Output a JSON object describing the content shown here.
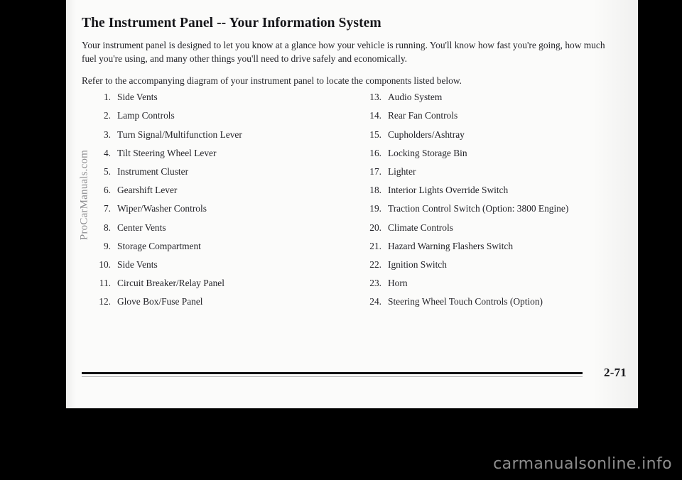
{
  "page": {
    "title": "The Instrument Panel -- Your Information System",
    "paragraphs": [
      "Your instrument panel is designed to let you know at a glance how your vehicle is running. You'll know how fast you're going, how much fuel you're using, and many other things you'll need to drive safely and economically.",
      "Refer to the accompanying diagram of your instrument panel to locate the components listed below."
    ],
    "folio": "2-71"
  },
  "components": {
    "left": [
      {
        "num": "1.",
        "label": "Side Vents"
      },
      {
        "num": "2.",
        "label": "Lamp Controls"
      },
      {
        "num": "3.",
        "label": "Turn Signal/Multifunction Lever"
      },
      {
        "num": "4.",
        "label": "Tilt Steering Wheel Lever"
      },
      {
        "num": "5.",
        "label": "Instrument Cluster"
      },
      {
        "num": "6.",
        "label": "Gearshift Lever"
      },
      {
        "num": "7.",
        "label": "Wiper/Washer Controls"
      },
      {
        "num": "8.",
        "label": "Center Vents"
      },
      {
        "num": "9.",
        "label": "Storage Compartment"
      },
      {
        "num": "10.",
        "label": "Side Vents"
      },
      {
        "num": "11.",
        "label": "Circuit Breaker/Relay Panel"
      },
      {
        "num": "12.",
        "label": "Glove Box/Fuse Panel"
      }
    ],
    "right": [
      {
        "num": "13.",
        "label": "Audio System"
      },
      {
        "num": "14.",
        "label": "Rear Fan Controls"
      },
      {
        "num": "15.",
        "label": "Cupholders/Ashtray"
      },
      {
        "num": "16.",
        "label": "Locking Storage Bin"
      },
      {
        "num": "17.",
        "label": "Lighter"
      },
      {
        "num": "18.",
        "label": "Interior Lights Override Switch"
      },
      {
        "num": "19.",
        "label": "Traction Control Switch (Option: 3800 Engine)"
      },
      {
        "num": "20.",
        "label": "Climate Controls"
      },
      {
        "num": "21.",
        "label": "Hazard Warning Flashers Switch"
      },
      {
        "num": "22.",
        "label": "Ignition Switch"
      },
      {
        "num": "23.",
        "label": "Horn"
      },
      {
        "num": "24.",
        "label": "Steering Wheel Touch Controls (Option)"
      }
    ]
  },
  "watermarks": {
    "side": "ProCarManuals.com",
    "site": "carmanualsonline.info"
  },
  "colors": {
    "backdrop": "#000000",
    "paper": "#fbfbfa",
    "ink": "#25252a",
    "rule": "#121214",
    "watermark": "#8e8e8e"
  }
}
